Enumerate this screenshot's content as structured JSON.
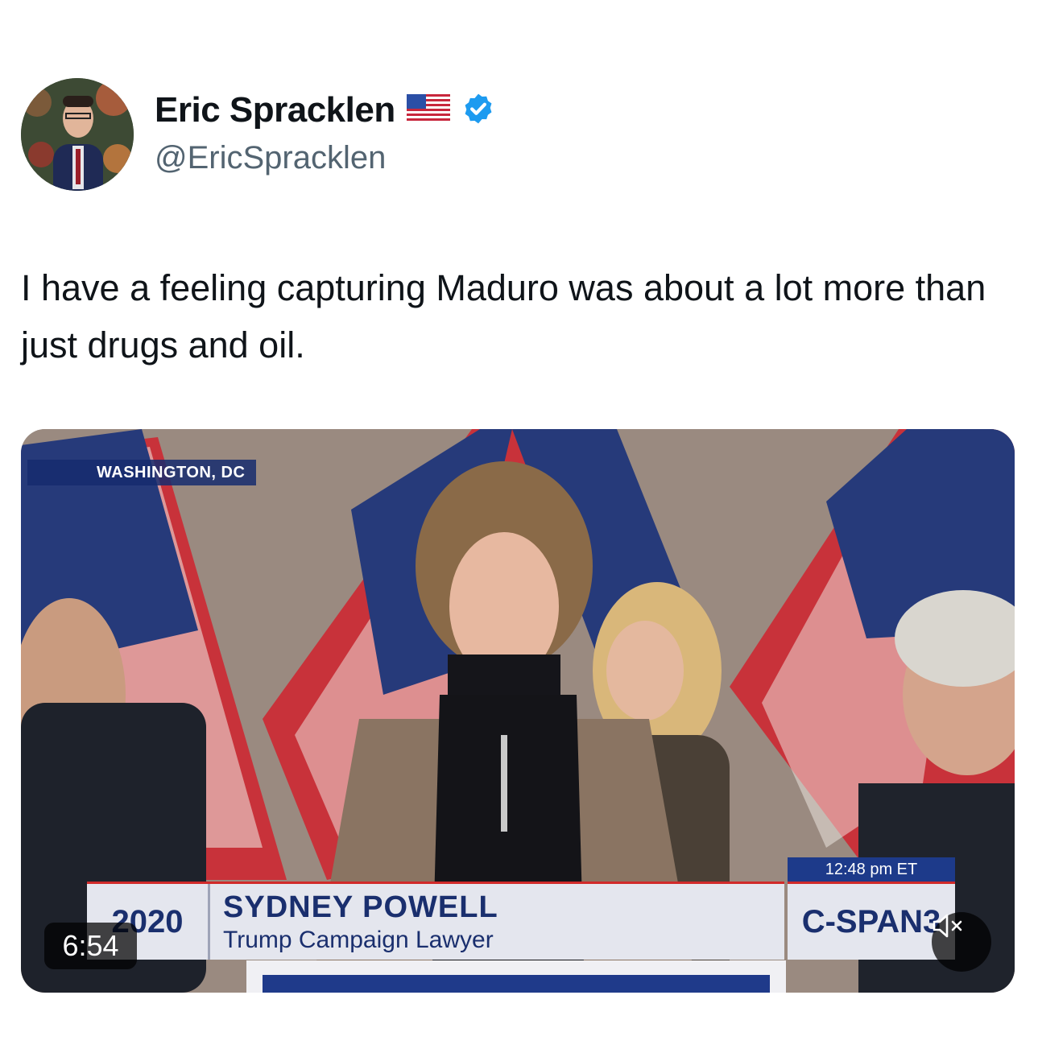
{
  "author": {
    "name": "Eric Spracklen",
    "handle": "@EricSpracklen",
    "flag_icon": "us-flag-icon",
    "verified_icon": "verified-badge-icon",
    "verified_color": "#1d9bf0"
  },
  "tweet": {
    "text": "I have a feeling capturing Maduro was about a lot more than just drugs and oil."
  },
  "video": {
    "location": "WASHINGTON, DC",
    "logo_text": "2020",
    "chyron_name": "SYDNEY POWELL",
    "chyron_role": "Trump Campaign Lawyer",
    "time": "12:48 pm ET",
    "network": "C-SPAN3",
    "duration": "6:54",
    "mute_icon": "speaker-muted-icon"
  }
}
